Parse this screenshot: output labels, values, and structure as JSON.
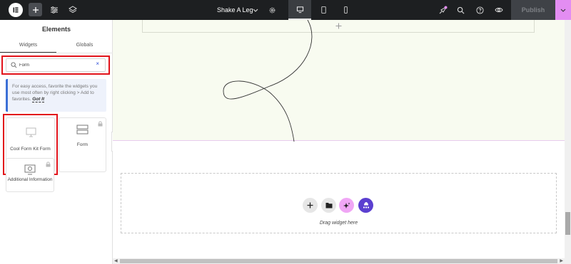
{
  "topbar": {
    "page_name": "Shake A Leg",
    "publish_label": "Publish",
    "icons": [
      "elementor-logo-icon",
      "plus-icon",
      "sliders-icon",
      "layers-icon",
      "chevron-down-icon",
      "gear-icon",
      "desktop-icon",
      "tablet-icon",
      "mobile-icon",
      "notes-icon",
      "search-icon",
      "help-icon",
      "eye-icon",
      "chevron-down-icon"
    ],
    "colors": {
      "bar": "#1d1f21",
      "publish_arrow": "#e38df2"
    }
  },
  "panel": {
    "title": "Elements",
    "tabs": [
      "Widgets",
      "Globals"
    ],
    "active_tab": "Widgets",
    "search": {
      "value": "Form"
    },
    "info": {
      "text": "For easy access, favorite the widgets you use most often by right clicking > Add to favorites.",
      "link": "Got It"
    },
    "widgets": [
      {
        "label": "Cool Form Kit Form",
        "icon": "form-kit-icon",
        "locked": false
      },
      {
        "label": "Form",
        "icon": "form-icon",
        "locked": true
      },
      {
        "label": "Additional Information",
        "icon": "info-icon",
        "locked": true
      }
    ]
  },
  "canvas": {
    "dropzone_text": "Drag widget here",
    "dropzone_buttons": [
      "plus-icon",
      "folder-icon",
      "ai-sparkle-icon",
      "kit-icon"
    ]
  }
}
